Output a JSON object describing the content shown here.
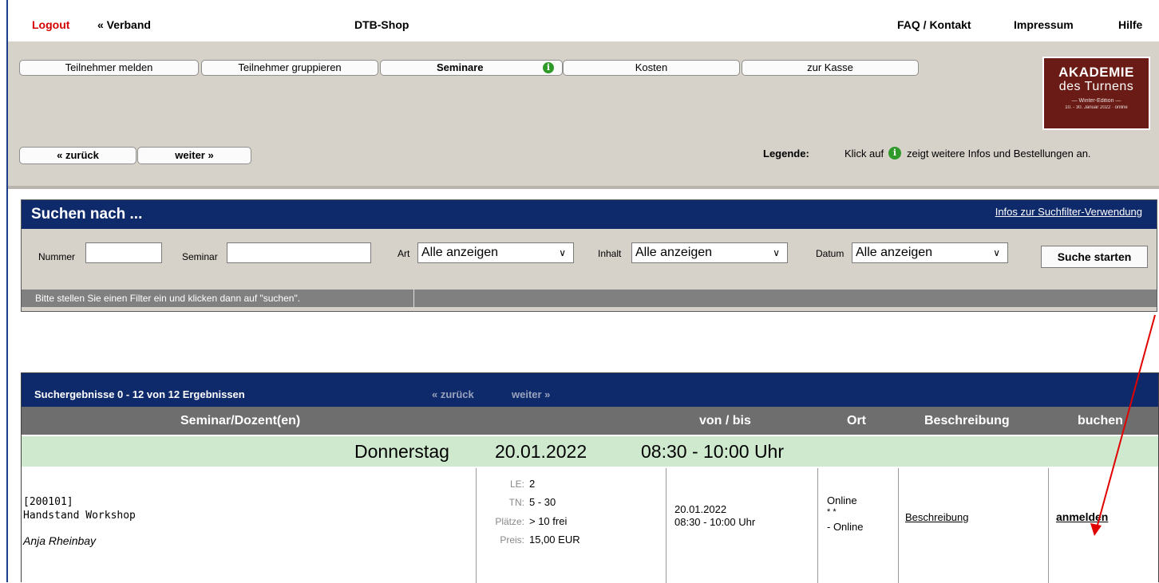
{
  "topbar": {
    "logout": "Logout",
    "verband": "« Verband",
    "shop": "DTB-Shop",
    "faq": "FAQ / Kontakt",
    "impressum": "Impressum",
    "hilfe": "Hilfe"
  },
  "steps": {
    "teilnehmer_melden": "Teilnehmer melden",
    "teilnehmer_gruppieren": "Teilnehmer gruppieren",
    "seminare": "Seminare",
    "kosten": "Kosten",
    "zur_kasse": "zur Kasse"
  },
  "nav": {
    "zurueck": "« zurück",
    "weiter": "weiter »"
  },
  "legend": {
    "label": "Legende:",
    "text_before": "Klick auf",
    "text_after": "zeigt weitere Infos und Bestellungen an."
  },
  "logo": {
    "line1": "AKADEMIE",
    "line2": "des Turnens",
    "line3": "— Winter-Edition —",
    "line4": "10. - 30. Januar 2022 · online"
  },
  "search": {
    "title": "Suchen nach ...",
    "info_link": "Infos zur Suchfilter-Verwendung",
    "nummer_label": "Nummer",
    "nummer_value": "",
    "seminar_label": "Seminar",
    "seminar_value": "",
    "art_label": "Art",
    "art_value": "Alle anzeigen",
    "inhalt_label": "Inhalt",
    "inhalt_value": "Alle anzeigen",
    "datum_label": "Datum",
    "datum_value": "Alle anzeigen",
    "button": "Suche starten",
    "status": "Bitte stellen Sie einen Filter ein und klicken dann auf \"suchen\"."
  },
  "results": {
    "title": "Suchergebnisse 0 - 12 von 12 Ergebnissen",
    "prev": "« zurück",
    "next": "weiter »",
    "columns": {
      "seminar": "Seminar/Dozent(en)",
      "vonbis": "von / bis",
      "ort": "Ort",
      "beschreibung": "Beschreibung",
      "buchen": "buchen"
    },
    "day": {
      "weekday": "Donnerstag",
      "date": "20.01.2022",
      "time": "08:30 - 10:00 Uhr"
    },
    "row": {
      "number": "[200101]",
      "name": "Handstand Workshop",
      "dozent": "Anja Rheinbay",
      "le_label": "LE:",
      "le_value": "2",
      "tn_label": "TN:",
      "tn_value": "5 - 30",
      "plaetze_label": "Plätze:",
      "plaetze_value": "> 10 frei",
      "preis_label": "Preis:",
      "preis_value": "15,00 EUR",
      "date": "20.01.2022",
      "time": "08:30 - 10:00 Uhr",
      "ort_line1": "Online",
      "ort_line2": "* *",
      "ort_line3": "- Online",
      "beschreibung": "Beschreibung",
      "anmelden": "anmelden"
    }
  },
  "colors": {
    "navy": "#0f2a6b",
    "panel": "#d6d1c9",
    "day_green": "#cfe9cf",
    "logout_red": "#d40000",
    "arrow_red": "#e00000"
  }
}
